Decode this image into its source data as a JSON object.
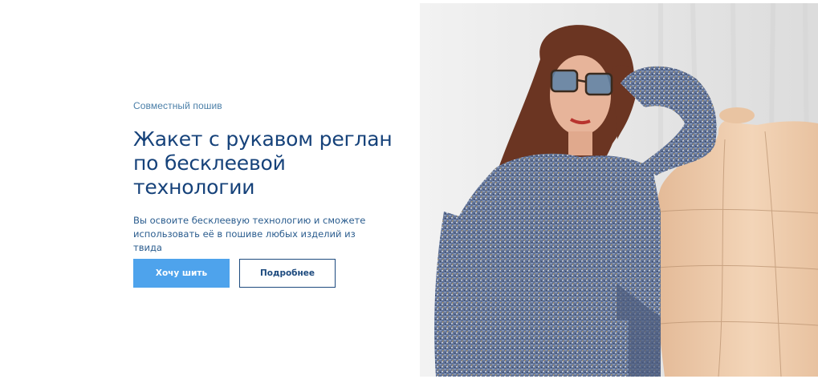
{
  "hero": {
    "eyebrow": "Совместный пошив",
    "title": "Жакет с рукавом реглан по бесклеевой технологии",
    "description": "Вы освоите бесклеевую технологию и сможете использовать её в пошиве любых изделий из твида",
    "primary_button": "Хочу шить",
    "secondary_button": "Подробнее"
  },
  "photo": {
    "subject": "photo-woman-tweed-jacket-mannequin"
  },
  "colors": {
    "heading": "#16427a",
    "accent": "#4ea3ec",
    "button_outline": "#1d4a7e"
  }
}
